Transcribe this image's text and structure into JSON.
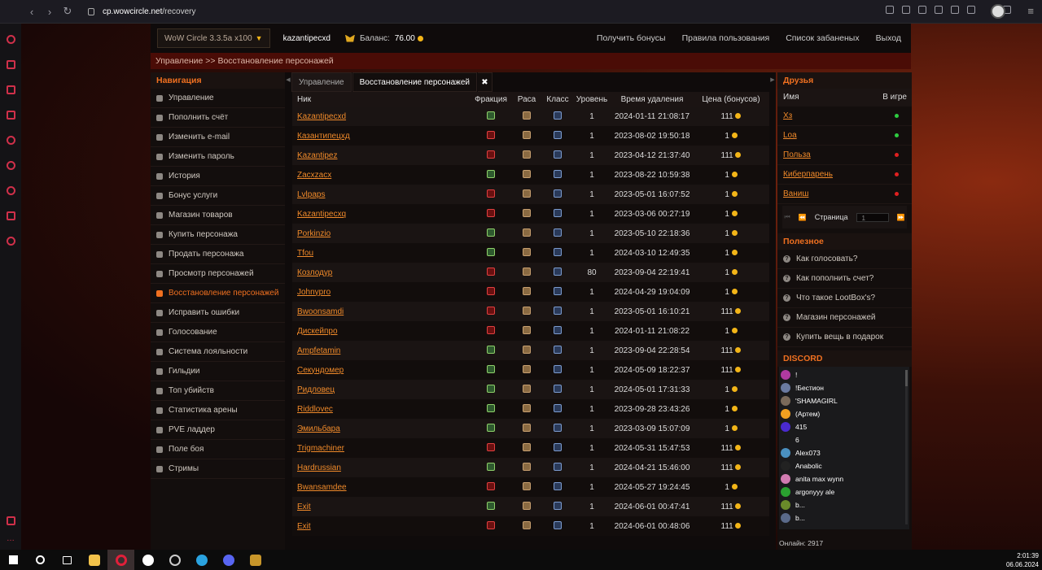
{
  "browser": {
    "url_host": "cp.wowcircle.net",
    "url_path": "/recovery"
  },
  "header": {
    "realm": "WoW Circle 3.3.5a x100",
    "username": "kazantipecxd",
    "balance_label": "Баланс:",
    "balance_value": "76.00",
    "links": [
      "Получить бонусы",
      "Правила пользования",
      "Список забаненых",
      "Выход"
    ]
  },
  "breadcrumb": "Управление >> Восстановление персонажей",
  "nav": {
    "title": "Навигация",
    "items": [
      "Управление",
      "Пополнить счёт",
      "Изменить e-mail",
      "Изменить пароль",
      "История",
      "Бонус услуги",
      "Магазин товаров",
      "Купить персонажа",
      "Продать персонажа",
      "Просмотр персонажей",
      "Восстановление персонажей",
      "Исправить ошибки",
      "Голосование",
      "Система лояльности",
      "Гильдии",
      "Топ убийств",
      "Статистика арены",
      "PVE ладдер",
      "Поле боя",
      "Стримы"
    ],
    "active": "Восстановление персонажей"
  },
  "tabs": [
    "Управление",
    "Восстановление персонажей"
  ],
  "table": {
    "headers": [
      "Ник",
      "Фракция",
      "Раса",
      "Класс",
      "Уровень",
      "Время удаления",
      "Цена (бонусов)"
    ],
    "rows": [
      {
        "nick": "Kazantipecxd",
        "fac": "A",
        "lvl": "1",
        "time": "2024-01-11 21:08:17",
        "price": "111"
      },
      {
        "nick": "Казантипецхд",
        "fac": "H",
        "lvl": "1",
        "time": "2023-08-02 19:50:18",
        "price": "1"
      },
      {
        "nick": "Kazantipez",
        "fac": "H",
        "lvl": "1",
        "time": "2023-04-12 21:37:40",
        "price": "111"
      },
      {
        "nick": "Zacxzacx",
        "fac": "A",
        "lvl": "1",
        "time": "2023-08-22 10:59:38",
        "price": "1"
      },
      {
        "nick": "Lvlpaps",
        "fac": "H",
        "lvl": "1",
        "time": "2023-05-01 16:07:52",
        "price": "1"
      },
      {
        "nick": "Kazantipecxq",
        "fac": "H",
        "lvl": "1",
        "time": "2023-03-06 00:27:19",
        "price": "1"
      },
      {
        "nick": "Porkinzio",
        "fac": "A",
        "lvl": "1",
        "time": "2023-05-10 22:18:36",
        "price": "1"
      },
      {
        "nick": "Tfou",
        "fac": "A",
        "lvl": "1",
        "time": "2024-03-10 12:49:35",
        "price": "1"
      },
      {
        "nick": "Козлодур",
        "fac": "H",
        "lvl": "80",
        "time": "2023-09-04 22:19:41",
        "price": "1"
      },
      {
        "nick": "Johnypro",
        "fac": "H",
        "lvl": "1",
        "time": "2024-04-29 19:04:09",
        "price": "1"
      },
      {
        "nick": "Bwoonsamdi",
        "fac": "H",
        "lvl": "1",
        "time": "2023-05-01 16:10:21",
        "price": "111"
      },
      {
        "nick": "Дискейпро",
        "fac": "H",
        "lvl": "1",
        "time": "2024-01-11 21:08:22",
        "price": "1"
      },
      {
        "nick": "Ampfetamin",
        "fac": "A",
        "lvl": "1",
        "time": "2023-09-04 22:28:54",
        "price": "111"
      },
      {
        "nick": "Секундомер",
        "fac": "A",
        "lvl": "1",
        "time": "2024-05-09 18:22:37",
        "price": "111"
      },
      {
        "nick": "Ридловец",
        "fac": "A",
        "lvl": "1",
        "time": "2024-05-01 17:31:33",
        "price": "1"
      },
      {
        "nick": "Riddlovec",
        "fac": "A",
        "lvl": "1",
        "time": "2023-09-28 23:43:26",
        "price": "1"
      },
      {
        "nick": "Эмильбара",
        "fac": "A",
        "lvl": "1",
        "time": "2023-03-09 15:07:09",
        "price": "1"
      },
      {
        "nick": "Trigmachiner",
        "fac": "H",
        "lvl": "1",
        "time": "2024-05-31 15:47:53",
        "price": "111"
      },
      {
        "nick": "Hardrussian",
        "fac": "A",
        "lvl": "1",
        "time": "2024-04-21 15:46:00",
        "price": "111"
      },
      {
        "nick": "Bwansamdee",
        "fac": "H",
        "lvl": "1",
        "time": "2024-05-27 19:24:45",
        "price": "1"
      },
      {
        "nick": "Exit",
        "fac": "A",
        "lvl": "1",
        "time": "2024-06-01 00:47:41",
        "price": "111"
      },
      {
        "nick": "Exit",
        "fac": "H",
        "lvl": "1",
        "time": "2024-06-01 00:48:06",
        "price": "111"
      }
    ]
  },
  "friends": {
    "title": "Друзья",
    "col_name": "Имя",
    "col_ingame": "В игре",
    "list": [
      {
        "name": "Хз",
        "status": "#2ecc40"
      },
      {
        "name": "Loa",
        "status": "#2ecc40"
      },
      {
        "name": "Польза",
        "status": "#e02020"
      },
      {
        "name": "Киберпарень",
        "status": "#e02020"
      },
      {
        "name": "Ваниш",
        "status": "#e02020"
      }
    ],
    "page_label": "Страница",
    "page_value": "1"
  },
  "useful": {
    "title": "Полезное",
    "items": [
      "Как голосовать?",
      "Как пополнить счет?",
      "Что такое LootBox's?",
      "Магазин персонажей",
      "Купить вещь в подарок"
    ]
  },
  "discord": {
    "title": "DISCORD",
    "users": [
      "!",
      "!Бестион",
      "'SHAMAGIRL",
      "(Артем)",
      "415",
      "6",
      "Alex073",
      "Anabolic",
      "anita max wynn",
      "argonyyy ale",
      "b...",
      "b..."
    ],
    "online": "Онлайн: 2917"
  },
  "clock": {
    "time": "2:01:39",
    "date": "06.06.2024"
  }
}
